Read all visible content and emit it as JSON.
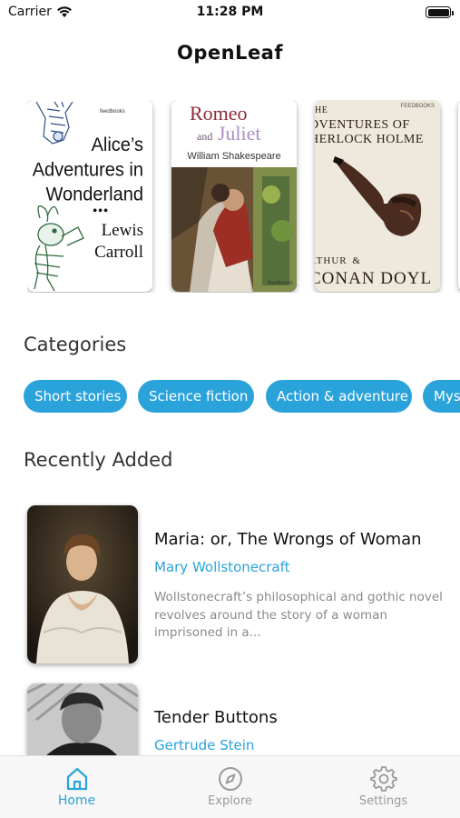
{
  "status_bar": {
    "carrier": "Carrier",
    "time": "11:28 PM"
  },
  "app": {
    "title": "OpenLeaf"
  },
  "featured_books": [
    {
      "cover_title_lines": [
        "Alice’s",
        "Adventures in",
        "Wonderland"
      ],
      "cover_dots": "•••",
      "cover_author_lines": [
        "Lewis",
        "Carroll"
      ],
      "publisher": "feedbooks"
    },
    {
      "cover_title_top": "Romeo",
      "cover_title_and": "and",
      "cover_title_bottom": "Juliet",
      "cover_author": "William Shakespeare",
      "publisher": "feedbooks"
    },
    {
      "cover_title_lines": [
        "HE",
        "DVENTURES OF",
        "HERLOCK HOLME"
      ],
      "cover_author_top": "RTHUR",
      "cover_author_amp": "&",
      "cover_author_bottom": "CONAN DOYL",
      "publisher": "FEEDBOOKS"
    }
  ],
  "categories": {
    "heading": "Categories",
    "items": [
      "Short stories",
      "Science fiction",
      "Action & adventure",
      "Mys"
    ]
  },
  "recently_added": {
    "heading": "Recently Added",
    "items": [
      {
        "title": "Maria: or, The Wrongs of Woman",
        "author": "Mary Wollstonecraft",
        "description": "Wollstonecraft’s philosophical and gothic novel revolves around the story of a woman imprisoned in a..."
      },
      {
        "title": "Tender Buttons",
        "author": "Gertrude Stein",
        "description": ""
      }
    ]
  },
  "tab_bar": {
    "tabs": [
      {
        "label": "Home",
        "icon": "home-icon",
        "active": true
      },
      {
        "label": "Explore",
        "icon": "compass-icon",
        "active": false
      },
      {
        "label": "Settings",
        "icon": "gear-icon",
        "active": false
      }
    ]
  },
  "colors": {
    "accent": "#2aa3db",
    "inactive_tab": "#9a9a9a",
    "description": "#8a8a8a"
  }
}
